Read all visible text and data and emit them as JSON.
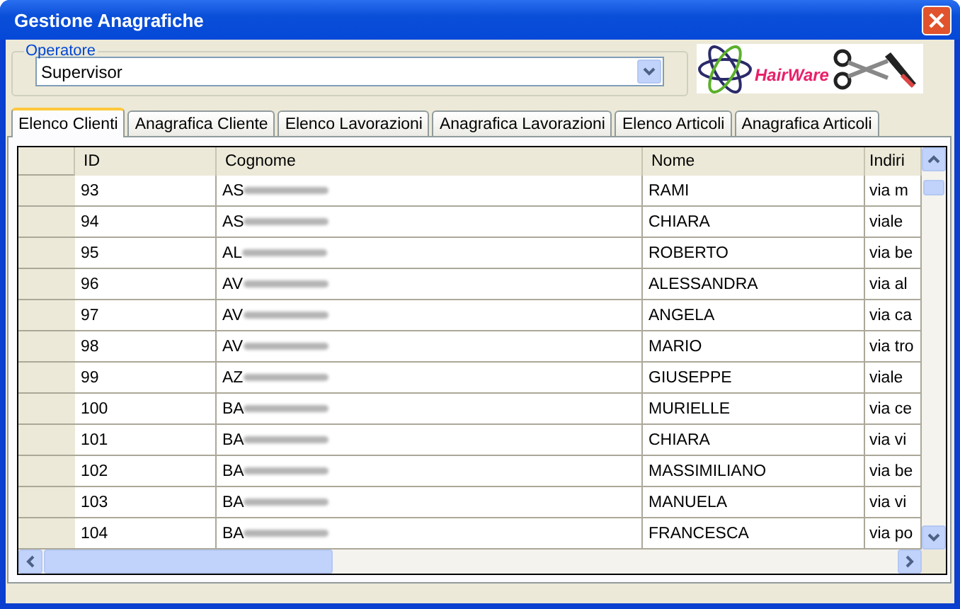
{
  "window": {
    "title": "Gestione Anagrafiche"
  },
  "operator": {
    "label": "Operatore",
    "value": "Supervisor"
  },
  "logo": {
    "text": "HairWare"
  },
  "tabs": [
    {
      "label": "Elenco Clienti",
      "selected": true
    },
    {
      "label": "Anagrafica Cliente",
      "selected": false
    },
    {
      "label": "Elenco Lavorazioni",
      "selected": false
    },
    {
      "label": "Anagrafica Lavorazioni",
      "selected": false
    },
    {
      "label": "Elenco Articoli",
      "selected": false
    },
    {
      "label": "Anagrafica Articoli",
      "selected": false
    }
  ],
  "table": {
    "columns": [
      "ID",
      "Cognome",
      "Nome",
      "Indiri"
    ],
    "rows": [
      {
        "id": "93",
        "cognome": "AS",
        "nome": "RAMI",
        "indirizzo": "via m"
      },
      {
        "id": "94",
        "cognome": "AS",
        "nome": "CHIARA",
        "indirizzo": "viale"
      },
      {
        "id": "95",
        "cognome": "AL",
        "nome": "ROBERTO",
        "indirizzo": "via be"
      },
      {
        "id": "96",
        "cognome": "AV",
        "nome": "ALESSANDRA",
        "indirizzo": "via al"
      },
      {
        "id": "97",
        "cognome": "AV",
        "nome": "ANGELA",
        "indirizzo": "via ca"
      },
      {
        "id": "98",
        "cognome": "AV",
        "nome": "MARIO",
        "indirizzo": "via tro"
      },
      {
        "id": "99",
        "cognome": "AZ",
        "nome": "GIUSEPPE",
        "indirizzo": "viale"
      },
      {
        "id": "100",
        "cognome": "BA",
        "nome": "MURIELLE",
        "indirizzo": "via ce"
      },
      {
        "id": "101",
        "cognome": "BA",
        "nome": "CHIARA",
        "indirizzo": "via vi"
      },
      {
        "id": "102",
        "cognome": "BA",
        "nome": "MASSIMILIANO",
        "indirizzo": "via be"
      },
      {
        "id": "103",
        "cognome": "BA",
        "nome": "MANUELA",
        "indirizzo": "via vi"
      },
      {
        "id": "104",
        "cognome": "BA",
        "nome": "FRANCESCA",
        "indirizzo": "via po"
      }
    ]
  }
}
